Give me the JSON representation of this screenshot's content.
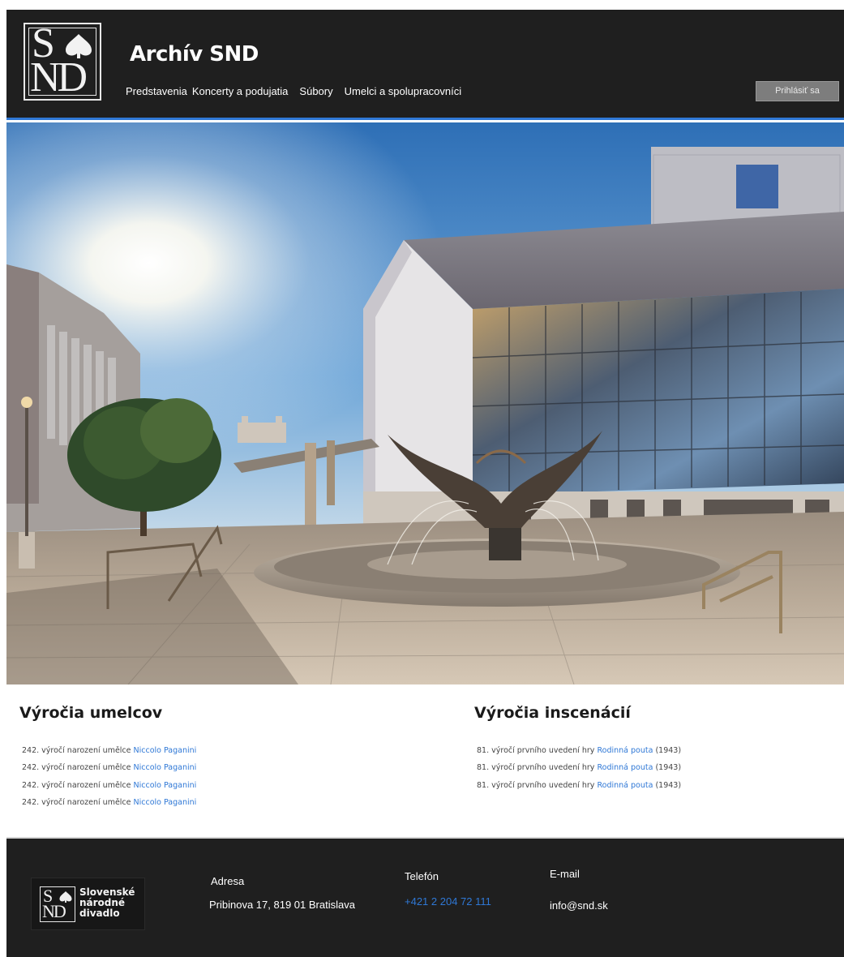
{
  "header": {
    "title": "Archív SND",
    "logo_letters": {
      "top": "S",
      "bottom": "ND"
    },
    "nav": [
      {
        "label": "Predstavenia"
      },
      {
        "label": "Koncerty a podujatia"
      },
      {
        "label": "Súbory"
      },
      {
        "label": "Umelci a spolupracovníci"
      }
    ],
    "login_label": "Prihlásiť sa"
  },
  "colors": {
    "header_bg": "#1f1f1f",
    "accent": "#2f78d6",
    "footer_bg": "#1f1f1f"
  },
  "artists": {
    "title": "Výročia umelcov",
    "items": [
      {
        "prefix": "242. výročí narození umělce",
        "link": "Niccolo Paganini"
      },
      {
        "prefix": "242. výročí narození umělce",
        "link": "Niccolo Paganini"
      },
      {
        "prefix": "242. výročí narození umělce",
        "link": "Niccolo Paganini"
      },
      {
        "prefix": "242. výročí narození umělce",
        "link": "Niccolo Paganini"
      }
    ]
  },
  "productions": {
    "title": "Výročia inscenácií",
    "items": [
      {
        "prefix": "81. výročí prvního uvedení hry",
        "link": "Rodinná pouta",
        "suffix": "(1943)"
      },
      {
        "prefix": "81. výročí prvního uvedení hry",
        "link": "Rodinná pouta",
        "suffix": "(1943)"
      },
      {
        "prefix": "81. výročí prvního uvedení hry",
        "link": "Rodinná pouta",
        "suffix": "(1943)"
      }
    ]
  },
  "footer": {
    "logo_text": [
      "Slovenské",
      "národné",
      "divadlo"
    ],
    "address_label": "Adresa",
    "address_value": "Pribinova 17, 819 01 Bratislava",
    "phone_label": "Telefón",
    "phone_value": "+421 2 204 72 111",
    "email_label": "E-mail",
    "email_value": "info@snd.sk"
  }
}
